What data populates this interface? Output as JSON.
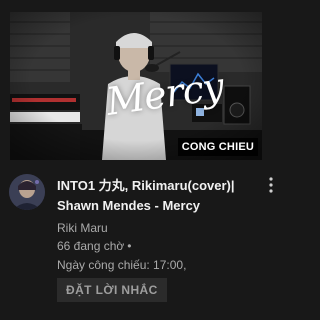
{
  "video": {
    "thumbnail": {
      "overlay_text": "Mercy",
      "badge": "CONG CHIEU"
    },
    "title": "INTO1 力丸, Rikimaru(cover)| Shawn Mendes - Mercy",
    "channel": "Riki Maru",
    "waiting": "66 đang chờ",
    "premiere": "Ngày công chiếu: 17:00,",
    "remind_button": "ĐẶT LỜI NHẮC"
  },
  "colors": {
    "background": "#181818",
    "secondary_text": "#aaaaaa",
    "button_bg": "#2b2b2b"
  }
}
